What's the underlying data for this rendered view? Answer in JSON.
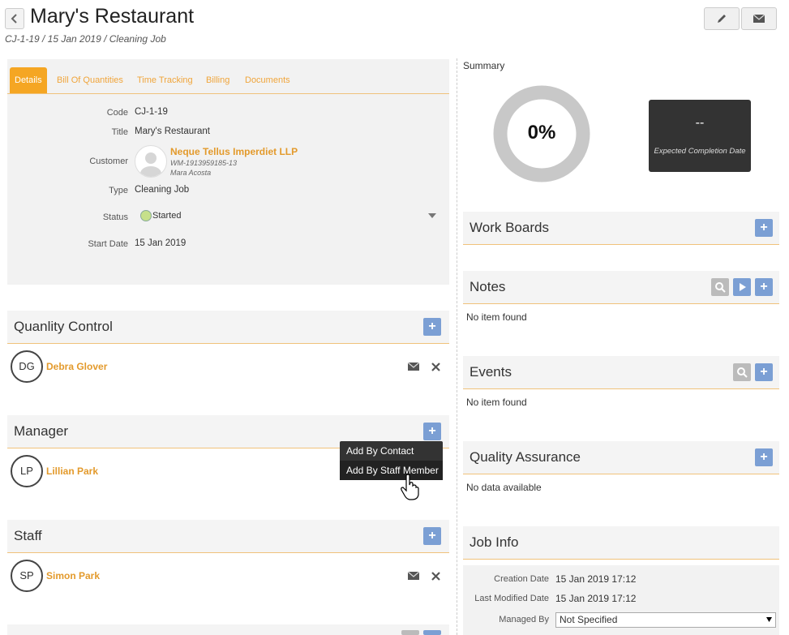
{
  "header": {
    "title": "Mary's Restaurant",
    "breadcrumb": "CJ-1-19 / 15 Jan 2019 / Cleaning Job"
  },
  "tabs": [
    "Details",
    "Bill Of Quantities",
    "Time Tracking",
    "Billing",
    "Documents"
  ],
  "details": {
    "code_label": "Code",
    "code": "CJ-1-19",
    "title_label": "Title",
    "title": "Mary's Restaurant",
    "customer_label": "Customer",
    "customer_name": "Neque Tellus Imperdiet LLP",
    "customer_ref": "WM-1913959185-13",
    "customer_contact": "Mara Acosta",
    "type_label": "Type",
    "type": "Cleaning Job",
    "status_label": "Status",
    "status": "Started",
    "start_label": "Start Date",
    "start": "15 Jan 2019"
  },
  "sections": {
    "quality_control": {
      "title": "Quanlity Control",
      "initials": "DG",
      "name": "Debra Glover"
    },
    "manager": {
      "title": "Manager",
      "initials": "LP",
      "name": "Lillian Park"
    },
    "staff": {
      "title": "Staff",
      "initials": "SP",
      "name": "Simon Park"
    }
  },
  "add_menu": [
    "Add By Contact",
    "Add By Staff Member"
  ],
  "summary": {
    "label": "Summary",
    "progress_text": "0%",
    "progress": 0,
    "completion_value": "--",
    "completion_label": "Expected Completion Date"
  },
  "right": {
    "work_boards": "Work Boards",
    "notes": "Notes",
    "notes_empty": "No item found",
    "events": "Events",
    "events_empty": "No item found",
    "qa": "Quality Assurance",
    "qa_empty": "No data available",
    "job_info": "Job Info"
  },
  "job_info": {
    "created_label": "Creation Date",
    "created": "15 Jan 2019 17:12",
    "modified_label": "Last Modified Date",
    "modified": "15 Jan 2019 17:12",
    "managed_label": "Managed By",
    "managed": "Not Specified"
  },
  "colors": {
    "accent": "#f5a623",
    "blue": "#7b9fd4",
    "link": "#e39a2c"
  }
}
